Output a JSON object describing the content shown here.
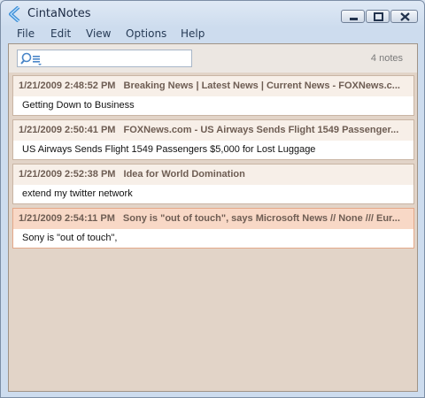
{
  "window": {
    "title": "CintaNotes"
  },
  "menu": [
    "File",
    "Edit",
    "View",
    "Options",
    "Help"
  ],
  "search": {
    "value": "",
    "placeholder": ""
  },
  "notes_count": "4 notes",
  "notes": [
    {
      "date": "1/21/2009 2:48:52 PM",
      "title": "Breaking News | Latest News | Current News - FOXNews.c...",
      "body": "Getting Down to Business",
      "selected": false
    },
    {
      "date": "1/21/2009 2:50:41 PM",
      "title": "FOXNews.com - US Airways Sends Flight 1549 Passenger...",
      "body": "US Airways Sends Flight 1549 Passengers $5,000 for Lost Luggage",
      "selected": false
    },
    {
      "date": "1/21/2009 2:52:38 PM",
      "title": "Idea for World Domination",
      "body": "extend my twitter network",
      "selected": false
    },
    {
      "date": "1/21/2009 2:54:11 PM",
      "title": "Sony is \"out of touch\", says Microsoft News // None /// Eur...",
      "body": "Sony is \"out of touch\",",
      "selected": true
    }
  ],
  "icons": {
    "app": "cintanotes-logo-icon",
    "search": "search-icon",
    "list": "list-icon"
  }
}
